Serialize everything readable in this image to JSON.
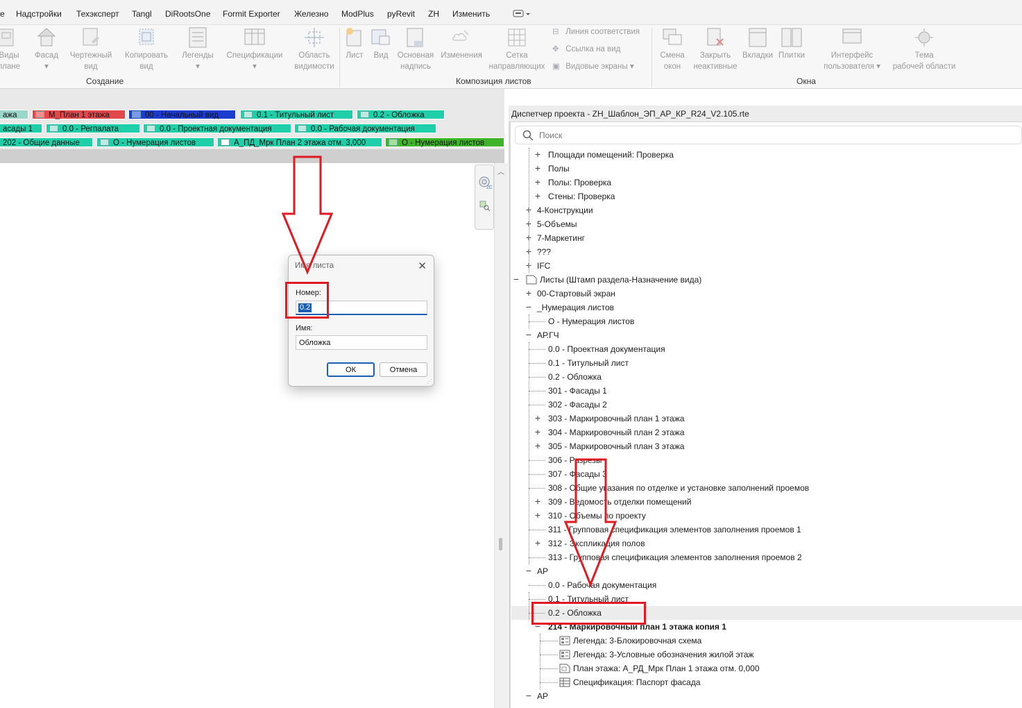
{
  "menu": {
    "items": [
      "е",
      "Надстройки",
      "Техэксперт",
      "Tangl",
      "DiRootsOne",
      "Formit Exporter",
      "Железно",
      "ModPlus",
      "pyRevit",
      "ZH",
      "Изменить"
    ]
  },
  "ribbon": {
    "create_group": "Создание",
    "sheet_group": "Композиция листов",
    "windows_group": "Окна",
    "buttons": {
      "views_plan": [
        "Виды",
        "плане"
      ],
      "facade": "Фасад",
      "drafting_view": [
        "Чертежный",
        "вид"
      ],
      "copy_view": [
        "Копировать",
        "вид"
      ],
      "legends": "Легенды",
      "schedules": "Спецификации",
      "scope_box": [
        "Область",
        "видимости"
      ],
      "sheet": "Лист",
      "view": "Вид",
      "title_block": [
        "Основная",
        "надпись"
      ],
      "revisions": "Изменения",
      "guide_grid": [
        "Сетка",
        "направляющих"
      ],
      "matchline": "Линия соответствия",
      "view_reference": "Ссылка на вид",
      "viewports": "Видовые экраны",
      "switch_windows": [
        "Смена",
        "окон"
      ],
      "close_inactive": [
        "Закрыть",
        "неактивные"
      ],
      "tabs": "Вкладки",
      "tile": "Плитки",
      "user_interface": [
        "Интерфейс",
        "пользователя"
      ],
      "theme": [
        "Тема",
        "рабочей области"
      ]
    }
  },
  "view_tabs": {
    "row1": [
      "ажа",
      "М_План 1 этажа",
      "00 - Начальный вид",
      "0.1 - Титульный лист",
      "0.2 - Обложка"
    ],
    "row2": [
      "асады 1",
      "0.0 - Регпалата",
      "0.0 - Проектная документация",
      "0.0 - Рабочая документация"
    ],
    "row3": [
      "202 - Общие данные",
      "О - Нумерация листов",
      "А_ПД_Мрк План 2 этажа отм. 3,000",
      "О - Нумерация листов"
    ]
  },
  "dialog": {
    "title": "Имя листа",
    "number_label": "Номер:",
    "number_value": "0.2",
    "name_label": "Имя:",
    "name_value": "Обложка",
    "ok_label": "ОК",
    "cancel_label": "Отмена"
  },
  "project_browser": {
    "title": "Диспетчер проекта - ZH_Шаблон_ЭП_АР_КР_R24_V2.105.rte",
    "search_placeholder": "Поиск",
    "rows": [
      {
        "label": "Площади помещений: Проверка",
        "level": 2,
        "toggle": "+"
      },
      {
        "label": "Полы",
        "level": 2,
        "toggle": "+"
      },
      {
        "label": "Полы: Проверка",
        "level": 2,
        "toggle": "+"
      },
      {
        "label": "Стены: Проверка",
        "level": 2,
        "toggle": "+"
      },
      {
        "label": "4-Конструкции",
        "level": 1,
        "toggle": "+"
      },
      {
        "label": "5-Объемы",
        "level": 1,
        "toggle": "+"
      },
      {
        "label": "7-Маркетинг",
        "level": 1,
        "toggle": "+"
      },
      {
        "label": "???",
        "level": 1,
        "toggle": "+"
      },
      {
        "label": "IFC",
        "level": 1,
        "toggle": "+"
      },
      {
        "label": "Листы (Штамп раздела-Назначение вида)",
        "level": 0,
        "toggle": "−",
        "icon": "sheet"
      },
      {
        "label": "00-Стартовый экран",
        "level": 1,
        "toggle": "+"
      },
      {
        "label": "_Нумерация листов",
        "level": 1,
        "toggle": "−"
      },
      {
        "label": "О - Нумерация листов",
        "level": 2,
        "toggle": ""
      },
      {
        "label": "АР.ГЧ",
        "level": 1,
        "toggle": "−"
      },
      {
        "label": "0.0 - Проектная документация",
        "level": 2,
        "toggle": ""
      },
      {
        "label": "0.1 - Титульный лист",
        "level": 2,
        "toggle": ""
      },
      {
        "label": "0.2 - Обложка",
        "level": 2,
        "toggle": ""
      },
      {
        "label": "301 - Фасады 1",
        "level": 2,
        "toggle": ""
      },
      {
        "label": "302 - Фасады 2",
        "level": 2,
        "toggle": ""
      },
      {
        "label": "303 - Маркировочный план 1 этажа",
        "level": 2,
        "toggle": "+"
      },
      {
        "label": "304 - Маркировочный план 2 этажа",
        "level": 2,
        "toggle": "+"
      },
      {
        "label": "305 - Маркировочный план 3 этажа",
        "level": 2,
        "toggle": "+"
      },
      {
        "label": "306 - Разрезы",
        "level": 2,
        "toggle": ""
      },
      {
        "label": "307 - Фасады 3",
        "level": 2,
        "toggle": ""
      },
      {
        "label": "308 - Общие указания по отделке и установке заполнений проемов",
        "level": 2,
        "toggle": ""
      },
      {
        "label": "309 - Ведомость отделки помещений",
        "level": 2,
        "toggle": "+"
      },
      {
        "label": "310 - Объемы по проекту",
        "level": 2,
        "toggle": "+"
      },
      {
        "label": "311 - Групповая спецификация элементов заполнения проемов 1",
        "level": 2,
        "toggle": ""
      },
      {
        "label": "312 - Экспликация полов",
        "level": 2,
        "toggle": "+"
      },
      {
        "label": "313 - Групповая спецификация элементов заполнения проемов 2",
        "level": 2,
        "toggle": ""
      },
      {
        "label": "АР",
        "level": 1,
        "toggle": "−"
      },
      {
        "label": "0.0 - Рабочая документация",
        "level": 2,
        "toggle": ""
      },
      {
        "label": "0.1 - Титульный лист",
        "level": 2,
        "toggle": ""
      },
      {
        "label": "0.2 - Обложка",
        "level": 2,
        "toggle": "",
        "selected": true
      },
      {
        "label": "214 - Маркировочный план 1 этажа копия 1",
        "level": 2,
        "toggle": "−",
        "bold": true
      },
      {
        "label": "Легенда: 3-Блокировочная схема",
        "level": 3,
        "toggle": "",
        "icon": "legend"
      },
      {
        "label": "Легенда: 3-Условные обозначения жилой этаж",
        "level": 3,
        "toggle": "",
        "icon": "legend"
      },
      {
        "label": "План этажа: А_РД_Мрк План 1 этажа отм. 0,000",
        "level": 3,
        "toggle": "",
        "icon": "plan"
      },
      {
        "label": "Спецификация: Паспорт фасада",
        "level": 3,
        "toggle": "",
        "icon": "schedule"
      },
      {
        "label": "АР",
        "level": 1,
        "toggle": "−"
      }
    ]
  },
  "colors": {
    "annotation_red": "#e01a22",
    "tab_teal": "#1ecfa9",
    "tab_red": "#e2474c",
    "tab_blue": "#1c3ccf",
    "tab_green": "#3fb42a",
    "selection_blue": "#1a5fb4"
  }
}
